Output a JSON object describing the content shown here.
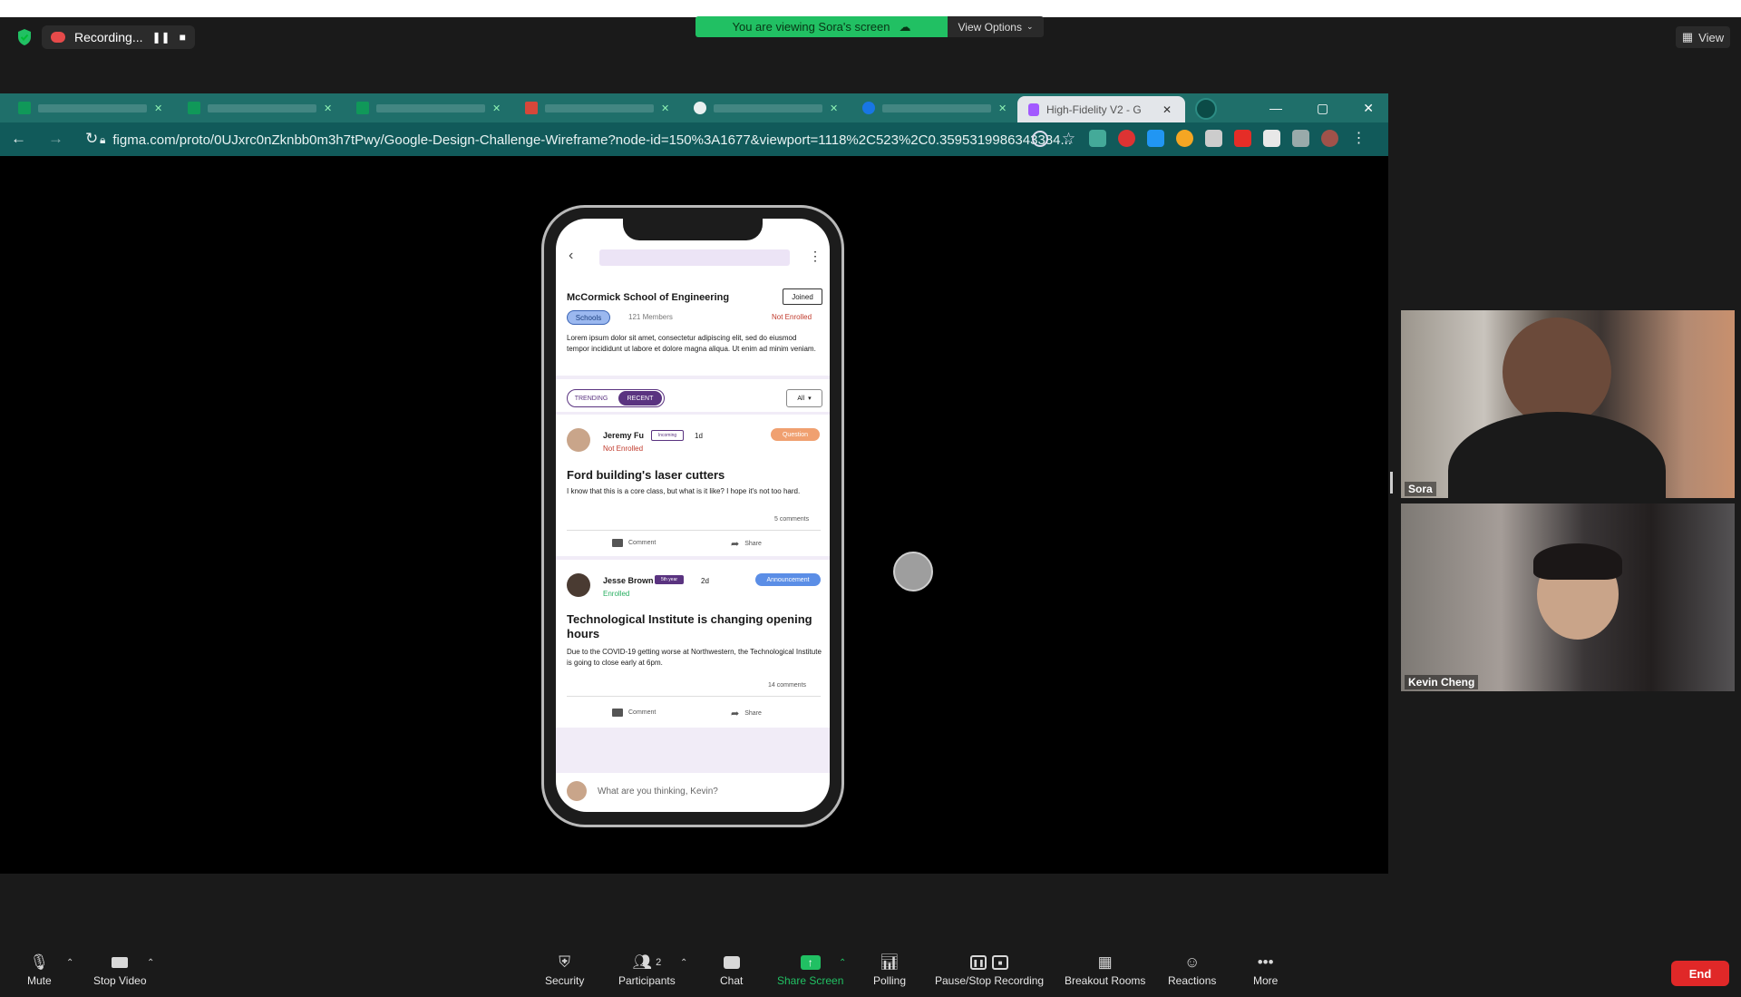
{
  "zoom": {
    "recording_label": "Recording...",
    "banner": "You are viewing Sora's screen",
    "view_options": "View Options",
    "view_button": "View",
    "participant_count": "2",
    "toolbar": {
      "mute": "Mute",
      "stop_video": "Stop Video",
      "security": "Security",
      "participants": "Participants",
      "chat": "Chat",
      "share_screen": "Share Screen",
      "polling": "Polling",
      "pause_stop_recording": "Pause/Stop Recording",
      "breakout_rooms": "Breakout Rooms",
      "reactions": "Reactions",
      "more": "More",
      "end": "End"
    },
    "gallery": [
      {
        "name": "Sora"
      },
      {
        "name": "Kevin Cheng"
      }
    ]
  },
  "browser": {
    "tabs": [
      {
        "icon": "sheets-icon",
        "color": "#0f9d58"
      },
      {
        "icon": "sheets-icon",
        "color": "#0f9d58"
      },
      {
        "icon": "sheets-icon",
        "color": "#0f9d58"
      },
      {
        "icon": "gmail-icon",
        "color": "#ea4335"
      },
      {
        "icon": "google-icon",
        "color": "#ffffff"
      },
      {
        "icon": "facebook-icon",
        "color": "#1877f2"
      }
    ],
    "active_tab_title": "High-Fidelity V2 - G",
    "url": "figma.com/proto/0UJxrc0nZknbb0m3h7tPwy/Google-Design-Challenge-Wireframe?node-id=150%3A1677&viewport=1118%2C523%2C0.3595319986343384..."
  },
  "app": {
    "group_name": "McCormick School of Engineering",
    "joined_label": "Joined",
    "category": "Schools",
    "members": "121 Members",
    "enroll_status": "Not Enrolled",
    "description": "Lorem ipsum dolor sit amet, consectetur adipiscing elit, sed do eiusmod tempor incididunt ut labore et dolore magna aliqua. Ut enim ad minim veniam.",
    "tab_trending": "TRENDING",
    "tab_recent": "RECENT",
    "filter": "All",
    "posts": [
      {
        "author": "Jeremy Fu",
        "badge": "Incoming",
        "time": "1d",
        "status": "Not Enrolled",
        "tag": "Question",
        "title": "Ford building's laser cutters",
        "body": "I know that this is a core class, but what is it like? I hope it's not too hard.",
        "comments": "5 comments",
        "comment_label": "Comment",
        "share_label": "Share"
      },
      {
        "author": "Jesse Brown",
        "badge": "5th year",
        "time": "2d",
        "status": "Enrolled",
        "tag": "Announcement",
        "title": "Technological Institute is changing opening hours",
        "body": "Due to the COVID-19 getting worse at Northwestern, the Technological Institute is going to close early at 6pm.",
        "comments": "14 comments",
        "comment_label": "Comment",
        "share_label": "Share"
      }
    ],
    "composer_placeholder": "What are you thinking, Kevin?"
  },
  "colors": {
    "zoom_green": "#21c063",
    "question_tag": "#f0a070",
    "announcement_tag": "#5b8ee6",
    "recent_tab": "#5a3380",
    "end_button": "#e02828"
  }
}
